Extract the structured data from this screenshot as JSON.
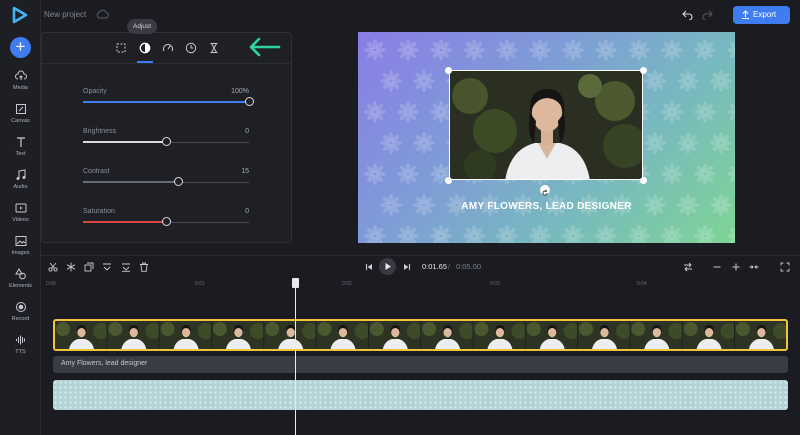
{
  "app": {
    "project_title": "New project",
    "export_label": "Export"
  },
  "sidebar": {
    "items": [
      {
        "label": "Media",
        "icon": "cloud-upload-icon"
      },
      {
        "label": "Canvas",
        "icon": "canvas-icon"
      },
      {
        "label": "Text",
        "icon": "text-icon"
      },
      {
        "label": "Audio",
        "icon": "music-note-icon"
      },
      {
        "label": "Videos",
        "icon": "video-icon"
      },
      {
        "label": "Images",
        "icon": "image-icon"
      },
      {
        "label": "Elements",
        "icon": "shapes-icon"
      },
      {
        "label": "Record",
        "icon": "record-icon"
      },
      {
        "label": "TTS",
        "icon": "waveform-icon"
      }
    ]
  },
  "adjust_panel": {
    "tooltip": "Adjust",
    "tabs": [
      "crop-icon",
      "adjust-icon",
      "speed-icon",
      "timer-icon",
      "hourglass-icon"
    ],
    "active_tab": "adjust-icon",
    "sliders": [
      {
        "name": "Opacity",
        "value": "100%",
        "fraction": 1.0,
        "fill_color": "#3f7cf0"
      },
      {
        "name": "Brightness",
        "value": "0",
        "fraction": 0.5,
        "fill_color": "#d8d9de"
      },
      {
        "name": "Contrast",
        "value": "15",
        "fraction": 0.575,
        "fill_color": "#6a6c74"
      },
      {
        "name": "Saturation",
        "value": "0",
        "fraction": 0.5,
        "fill_color": "#d9473f"
      }
    ]
  },
  "preview": {
    "caption": "AMY FLOWERS, LEAD DESIGNER"
  },
  "timeline": {
    "current_time": "0:01.65",
    "separator": "/",
    "total_time": "0:05.00",
    "ruler_ticks": [
      "0:00",
      "0:01",
      "0:02",
      "0:03",
      "0:04"
    ],
    "text_clip_label": "Amy Flowers, lead designer"
  },
  "colors": {
    "accent": "#3f7cf0",
    "clip_border": "#f0c43d",
    "arrow": "#2fd49a"
  }
}
